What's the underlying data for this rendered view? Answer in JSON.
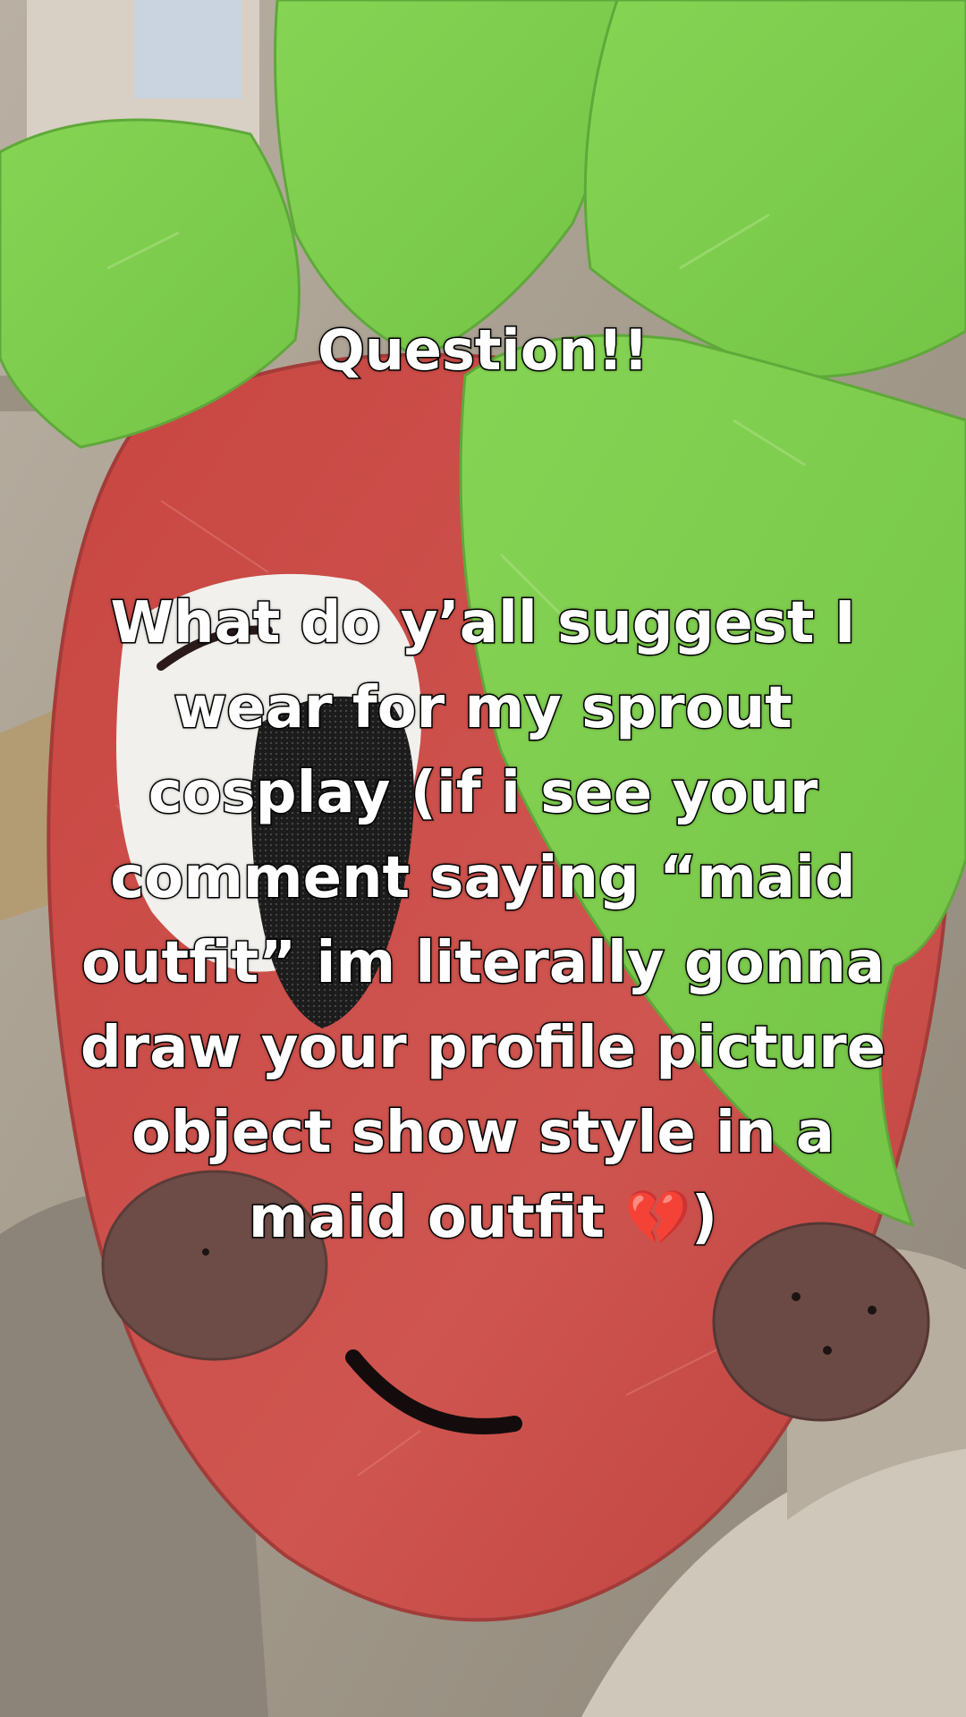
{
  "caption": {
    "title": "Question!!",
    "lines": [
      "What do y’all suggest I",
      "wear for my sprout",
      "cosplay (if i see your",
      "comment saying “maid",
      "outfit” im literally gonna",
      "draw your profile picture",
      "object show style in a"
    ],
    "last_line_text": "maid outfit ",
    "last_line_emoji": "💔",
    "last_line_close": ")"
  },
  "colors": {
    "leaf_green": "#7ed04f",
    "strawberry_red": "#c94a47",
    "cheek_brown": "#6b4a45",
    "background_beige": "#a79d8e",
    "text_fill": "#ffffff",
    "text_stroke": "#000000"
  },
  "icons": {
    "broken_heart": "broken-heart-icon"
  }
}
